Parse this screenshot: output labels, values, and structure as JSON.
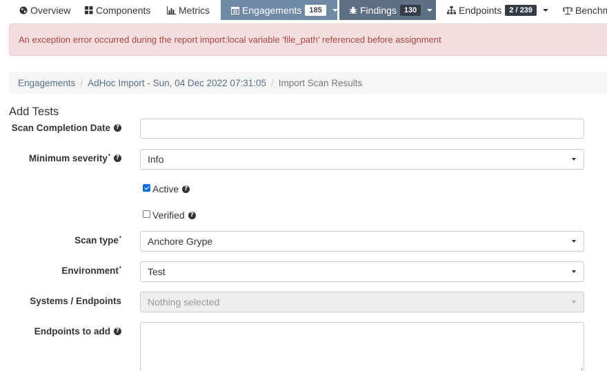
{
  "nav": {
    "overview": "Overview",
    "components": "Components",
    "metrics": "Metrics",
    "engagements": "Engagements",
    "engagements_count": "185",
    "findings": "Findings",
    "findings_count": "130",
    "endpoints": "Endpoints",
    "endpoints_count": "2 / 239",
    "benchmarks": "Benchm"
  },
  "alert": {
    "message": "An exception error occurred during the report import:local variable 'file_path' referenced before assignment"
  },
  "breadcrumb": {
    "items": [
      "Engagements",
      "AdHoc Import - Sun, 04 Dec 2022 07:31:05"
    ],
    "current": "Import Scan Results"
  },
  "form": {
    "title": "Add Tests",
    "scan_completion_date": {
      "label": "Scan Completion Date",
      "value": ""
    },
    "minimum_severity": {
      "label": "Minimum severity",
      "value": "Info"
    },
    "active": {
      "label": "Active",
      "checked": true
    },
    "verified": {
      "label": "Verified",
      "checked": false
    },
    "scan_type": {
      "label": "Scan type",
      "value": "Anchore Grype"
    },
    "environment": {
      "label": "Environment",
      "value": "Test"
    },
    "systems_endpoints": {
      "label": "Systems / Endpoints",
      "placeholder": "Nothing selected"
    },
    "endpoints_to_add": {
      "label": "Endpoints to add",
      "value": ""
    },
    "required_mark": "*",
    "help_glyph": "?"
  },
  "colors": {
    "nav_active": "#6f8aa5",
    "nav_dark": "#5d6f82",
    "alert_bg": "#f2dede",
    "alert_text": "#a94442",
    "link": "#5a6f86"
  }
}
